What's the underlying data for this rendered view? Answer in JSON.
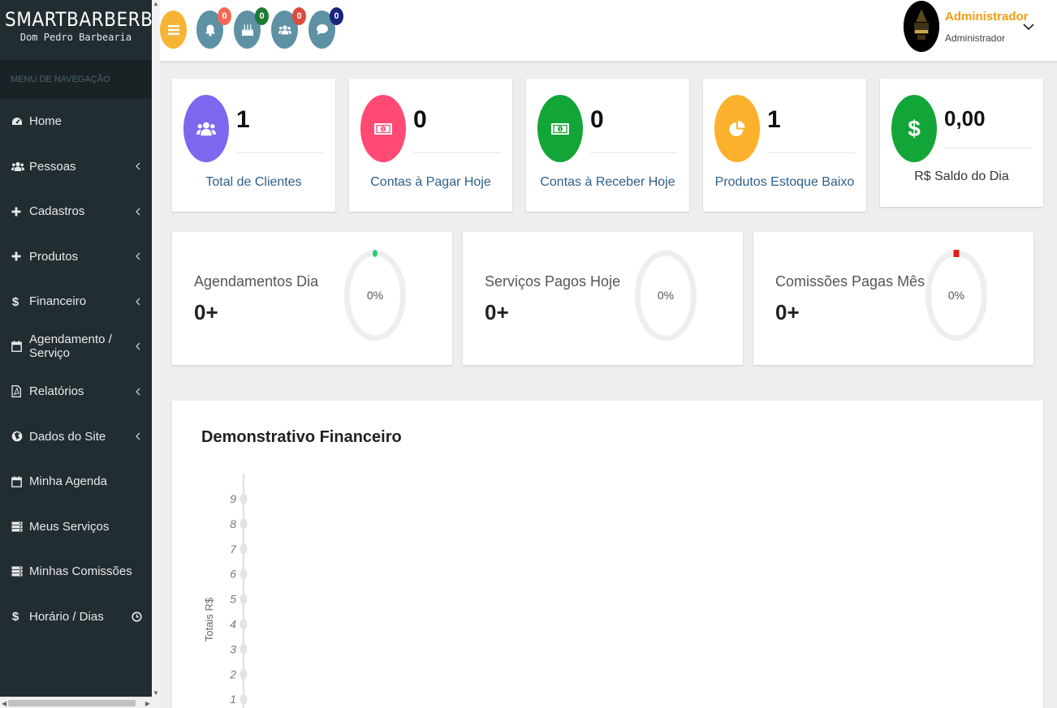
{
  "brand": {
    "title": "SMARTBARBERBR",
    "subtitle": "Dom Pedro Barbearia"
  },
  "sidebar": {
    "header": "MENU DE NAVEGAÇÃO",
    "items": [
      {
        "label": "Home",
        "icon": "dashboard-icon",
        "chevron": false
      },
      {
        "label": "Pessoas",
        "icon": "users-icon",
        "chevron": true
      },
      {
        "label": "Cadastros",
        "icon": "plus-icon",
        "chevron": true
      },
      {
        "label": "Produtos",
        "icon": "plus-icon",
        "chevron": true
      },
      {
        "label": "Financeiro",
        "icon": "dollar-icon",
        "chevron": true
      },
      {
        "label": "Agendamento / Serviço",
        "icon": "calendar-icon",
        "chevron": true
      },
      {
        "label": "Relatórios",
        "icon": "pdf-icon",
        "chevron": true
      },
      {
        "label": "Dados do Site",
        "icon": "globe-icon",
        "chevron": true
      },
      {
        "label": "Minha Agenda",
        "icon": "calendar-icon",
        "chevron": false
      },
      {
        "label": "Meus Serviços",
        "icon": "server-icon",
        "chevron": false
      },
      {
        "label": "Minhas Comissões",
        "icon": "server-icon",
        "chevron": false
      },
      {
        "label": "Horário / Dias",
        "icon": "dollar-icon",
        "chevron": false,
        "clock": true
      }
    ]
  },
  "topbar": {
    "notifications": [
      {
        "icon": "bell-icon",
        "count": "0",
        "badge_color": "#f56954"
      },
      {
        "icon": "birthday-cake-icon",
        "count": "0",
        "badge_color": "#1e7b36"
      },
      {
        "icon": "users-icon",
        "count": "0",
        "badge_color": "#dd4b39"
      },
      {
        "icon": "comment-icon",
        "count": "0",
        "badge_color": "#1a237e"
      }
    ],
    "user": {
      "name": "Administrador",
      "role": "Administrador"
    }
  },
  "stats": [
    {
      "value": "1",
      "label": "Total de Clientes",
      "color": "#7b68ee",
      "icon": "users-icon"
    },
    {
      "value": "0",
      "label": "Contas à Pagar Hoje",
      "color": "#ff4a73",
      "icon": "money-icon"
    },
    {
      "value": "0",
      "label": "Contas à Receber Hoje",
      "color": "#12a537",
      "icon": "money-icon"
    },
    {
      "value": "1",
      "label": "Produtos Estoque Baixo",
      "color": "#fbb12b",
      "icon": "pie-chart-icon"
    },
    {
      "value": "0,00",
      "label": "R$ Saldo do Dia",
      "color": "#12a537",
      "icon": "dollar-icon"
    }
  ],
  "donuts": [
    {
      "title": "Agendamentos Dia",
      "value": "0+",
      "percent": "0%",
      "marker_color": "#2ecc71"
    },
    {
      "title": "Serviços Pagos Hoje",
      "value": "0+",
      "percent": "0%",
      "marker_color": ""
    },
    {
      "title": "Comissões Pagas Mês",
      "value": "0+",
      "percent": "0%",
      "marker_color": "#e02020"
    }
  ],
  "financial": {
    "title": "Demonstrativo Financeiro",
    "chart_data": {
      "type": "line",
      "title": "Demonstrativo Financeiro",
      "ylabel": "Totais R$",
      "yticks": [
        "9",
        "8",
        "7",
        "6",
        "5",
        "4",
        "3",
        "2",
        "1"
      ],
      "ylim": [
        1,
        9
      ],
      "series": []
    }
  }
}
